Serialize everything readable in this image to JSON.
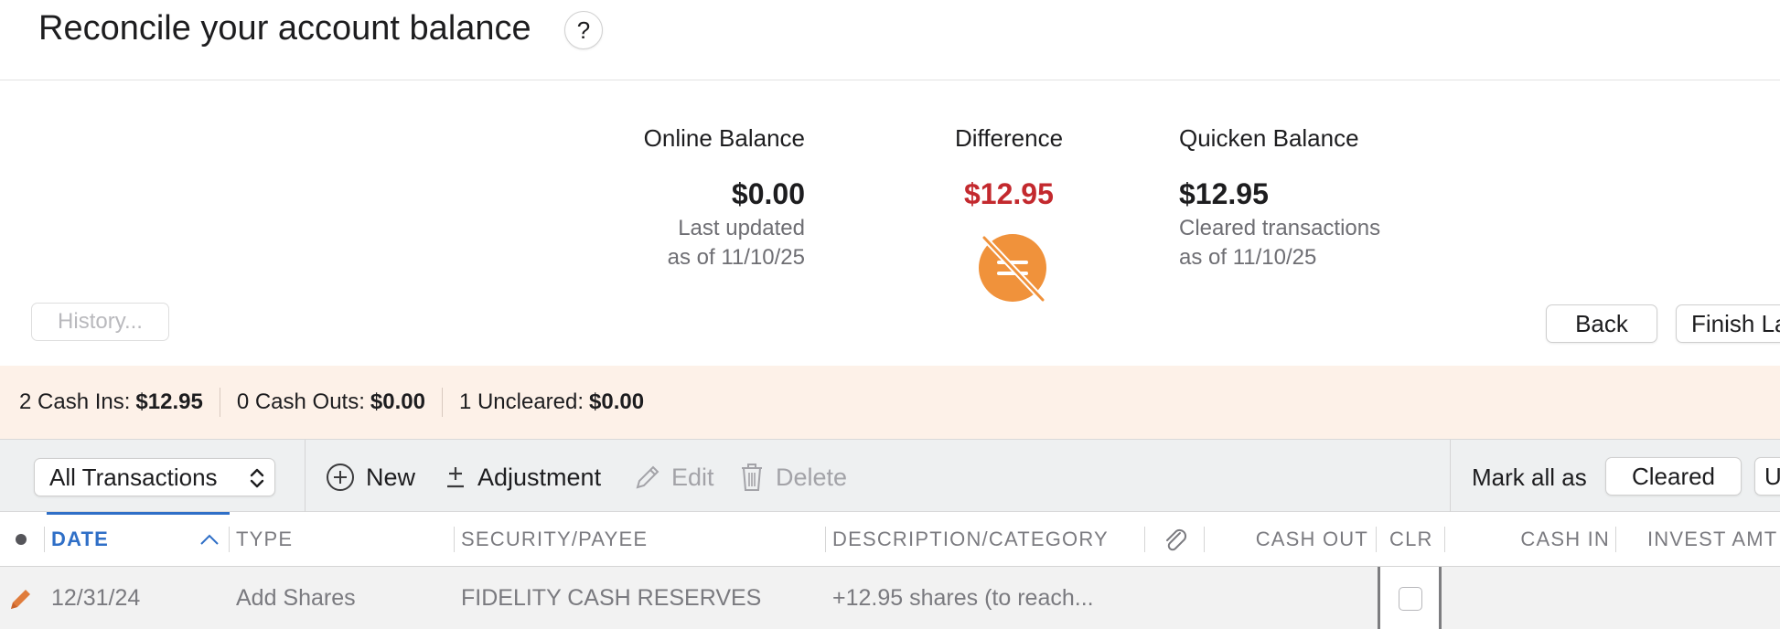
{
  "header": {
    "title": "Reconcile your account balance",
    "help_label": "?"
  },
  "balances": {
    "online": {
      "label": "Online Balance",
      "value": "$0.00",
      "sub1": "Last updated",
      "sub2": "as of 11/10/25"
    },
    "difference": {
      "label": "Difference",
      "value": "$12.95",
      "color": "#c3292e",
      "icon": "not-equal-icon",
      "icon_color": "#f0923b"
    },
    "quicken": {
      "label": "Quicken Balance",
      "value": "$12.95",
      "sub1": "Cleared transactions",
      "sub2": "as of 11/10/25"
    }
  },
  "buttons": {
    "history": "History...",
    "back": "Back",
    "finish": "Finish La"
  },
  "stats": [
    {
      "label": "2 Cash Ins:",
      "value": "$12.95"
    },
    {
      "label": "0 Cash Outs:",
      "value": "$0.00"
    },
    {
      "label": "1 Uncleared:",
      "value": "$0.00"
    }
  ],
  "toolbar": {
    "filter": "All Transactions",
    "new": "New",
    "adjustment": "Adjustment",
    "edit": "Edit",
    "delete": "Delete",
    "mark_all": "Mark all as",
    "cleared": "Cleared",
    "uncleared_partial": "U"
  },
  "columns": {
    "date": "DATE",
    "type": "TYPE",
    "security_payee": "SECURITY/PAYEE",
    "description_category": "DESCRIPTION/CATEGORY",
    "cash_out": "CASH OUT",
    "clr": "CLR",
    "cash_in": "CASH IN",
    "invest_amt": "INVEST AMT"
  },
  "rows": [
    {
      "date": "12/31/24",
      "type": "Add Shares",
      "security_payee": "FIDELITY CASH RESERVES",
      "description": "+12.95 shares (to reach...",
      "cleared": false
    }
  ]
}
